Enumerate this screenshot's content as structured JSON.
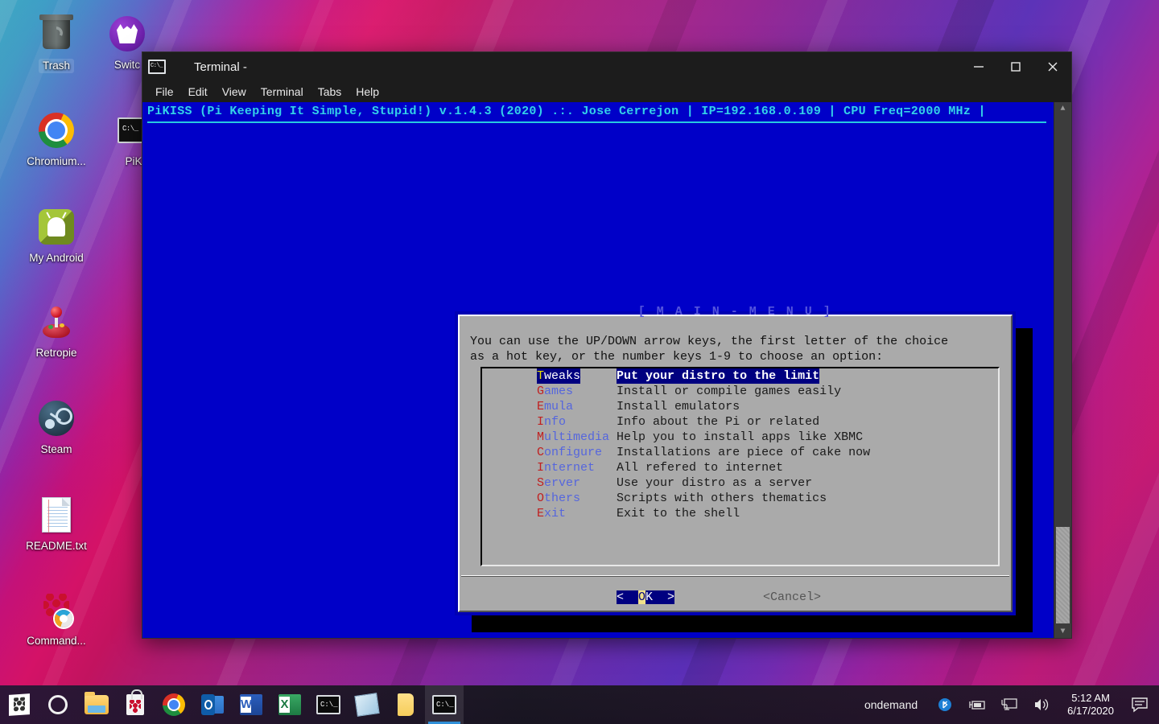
{
  "desktop": {
    "icons": [
      {
        "label": "Trash",
        "icon": "trash-icon",
        "selected": true
      },
      {
        "label": "Switc",
        "icon": "switch-icon",
        "selected": false
      },
      {
        "label": "Chromium...",
        "icon": "chromium-icon",
        "selected": false
      },
      {
        "label": "PiK",
        "icon": "pikiss-terminal-icon",
        "selected": false
      },
      {
        "label": "My Android",
        "icon": "android-icon",
        "selected": false
      },
      {
        "label": "Retropie",
        "icon": "retropie-joystick-icon",
        "selected": false
      },
      {
        "label": "Steam",
        "icon": "steam-icon",
        "selected": false
      },
      {
        "label": "README.txt",
        "icon": "text-document-icon",
        "selected": false
      },
      {
        "label": "Command...",
        "icon": "raspberry-pi-gauge-icon",
        "selected": false
      }
    ]
  },
  "window": {
    "title": "Terminal -",
    "app_icon": "terminal-icon",
    "controls": {
      "minimize": "minimize-icon",
      "maximize": "maximize-icon",
      "close": "close-icon"
    },
    "menubar": [
      "File",
      "Edit",
      "View",
      "Terminal",
      "Tabs",
      "Help"
    ]
  },
  "terminal": {
    "header_line": "PiKISS (Pi Keeping It Simple, Stupid!) v.1.4.3 (2020) .:. Jose Cerrejon | IP=192.168.0.109 | CPU Freq=2000 MHz |",
    "header_color": "#34d2e8",
    "background_color": "#0000c8",
    "scrollbar": {
      "up_arrow": "chevron-up-icon",
      "down_arrow": "chevron-down-icon"
    }
  },
  "dialog": {
    "title": "[ M A I N - M E N U ]",
    "prompt_line1": "You can use the UP/DOWN arrow keys, the first letter of the choice",
    "prompt_line2": "as a hot key, or the number keys 1-9 to choose an option:",
    "items": [
      {
        "hot": "T",
        "rest": "weaks",
        "tag": "Tweaks",
        "desc": "Put your distro to the limit",
        "selected": true
      },
      {
        "hot": "G",
        "rest": "ames",
        "tag": "Games",
        "desc": "Install or compile games easily",
        "selected": false
      },
      {
        "hot": "E",
        "rest": "mula",
        "tag": "Emula",
        "desc": "Install emulators",
        "selected": false
      },
      {
        "hot": "I",
        "rest": "nfo",
        "tag": "Info",
        "desc": "Info about the Pi or related",
        "selected": false
      },
      {
        "hot": "M",
        "rest": "ultimedia",
        "tag": "Multimedia",
        "desc": "Help you to install apps like XBMC",
        "selected": false
      },
      {
        "hot": "C",
        "rest": "onfigure",
        "tag": "Configure",
        "desc": "Installations are piece of cake now",
        "selected": false
      },
      {
        "hot": "I",
        "rest": "nternet",
        "tag": "Internet",
        "desc": "All refered to internet",
        "selected": false
      },
      {
        "hot": "S",
        "rest": "erver",
        "tag": "Server",
        "desc": "Use your distro as a server",
        "selected": false
      },
      {
        "hot": "O",
        "rest": "thers",
        "tag": "Others",
        "desc": "Scripts with others thematics",
        "selected": false
      },
      {
        "hot": "E",
        "rest": "xit",
        "tag": "Exit",
        "desc": "Exit to the shell",
        "selected": false
      }
    ],
    "ok_prefix": "<  ",
    "ok_hot": "O",
    "ok_rest": "K",
    "ok_suffix": "  >",
    "cancel_label": "<Cancel>",
    "selected_bg": "#000080",
    "hotkey_color": "#c02020",
    "tag_color": "#5566dd"
  },
  "taskbar": {
    "apps": [
      {
        "name": "raspberry-pi-doc-icon",
        "active": false
      },
      {
        "name": "ring-icon",
        "active": false
      },
      {
        "name": "file-manager-icon",
        "active": false
      },
      {
        "name": "pi-store-bag-icon",
        "active": false
      },
      {
        "name": "chromium-icon",
        "active": false
      },
      {
        "name": "outlook-icon",
        "active": false
      },
      {
        "name": "word-icon",
        "active": false
      },
      {
        "name": "excel-icon",
        "active": false
      },
      {
        "name": "terminal-icon",
        "active": false
      },
      {
        "name": "notepad-icon",
        "active": false
      },
      {
        "name": "sticky-note-icon",
        "active": false
      },
      {
        "name": "terminal-icon",
        "active": true
      }
    ],
    "governor": "ondemand",
    "tray": [
      {
        "name": "bluetooth-icon"
      },
      {
        "name": "battery-icon"
      },
      {
        "name": "network-display-icon"
      },
      {
        "name": "volume-icon"
      }
    ],
    "time": "5:12 AM",
    "date": "6/17/2020",
    "notification_icon": "notification-icon"
  }
}
